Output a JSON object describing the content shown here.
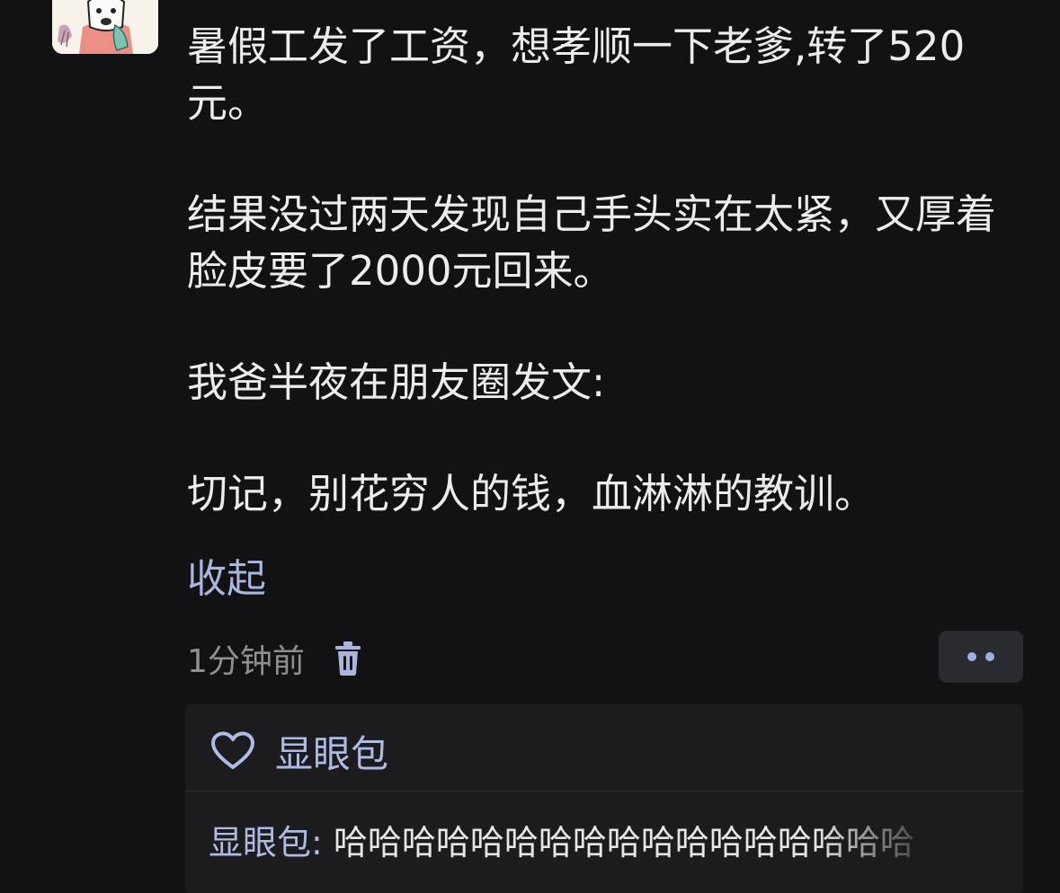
{
  "post": {
    "paragraphs": [
      "暑假工发了工资，想孝顺一下老爹,转了520元。",
      "结果没过两天发现自己手头实在太紧，又厚着脸皮要了2000元回来。",
      "我爸半夜在朋友圈发文:",
      "切记，别花穷人的钱，血淋淋的教训。"
    ],
    "collapse_label": "收起",
    "timestamp": "1分钟前",
    "delete_icon": "trash-icon",
    "more_icon": "more-dots-icon"
  },
  "interactions": {
    "like_icon": "heart-outline-icon",
    "liker": "显眼包",
    "comment": {
      "author": "显眼包",
      "separator": ": ",
      "text": "哈哈哈哈哈哈哈哈哈哈哈哈哈哈哈哈哈"
    }
  },
  "colors": {
    "background": "#121214",
    "text": "#ececee",
    "link": "#a8b6e0",
    "muted": "#8e8e93",
    "panel": "#1c1c1f"
  }
}
